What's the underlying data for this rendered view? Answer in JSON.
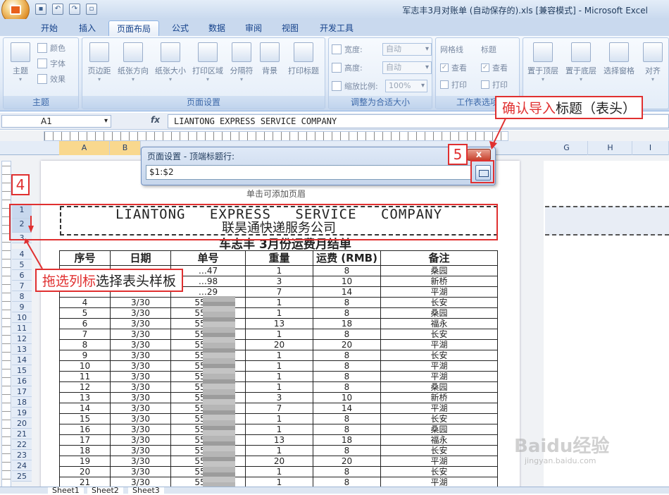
{
  "window": {
    "title": "军志丰3月对账单 (自动保存的).xls  [兼容模式] - Microsoft Excel"
  },
  "ribbon_tabs": [
    "开始",
    "插入",
    "页面布局",
    "公式",
    "数据",
    "审阅",
    "视图",
    "开发工具"
  ],
  "groups": {
    "theme": {
      "label": "主题",
      "big": "主题",
      "items": [
        "颜色",
        "字体",
        "效果"
      ]
    },
    "page_setup": {
      "label": "页面设置",
      "buttons": [
        "页边距",
        "纸张方向",
        "纸张大小",
        "打印区域",
        "分隔符",
        "背景",
        "打印标题"
      ]
    },
    "scale": {
      "label": "调整为合适大小",
      "width_label": "宽度:",
      "width_val": "自动",
      "height_label": "高度:",
      "height_val": "自动",
      "scale_label": "缩放比例:",
      "scale_val": "100%"
    },
    "sheet_opts": {
      "label": "工作表选项",
      "gridlines": "网格线",
      "headings": "标题",
      "view": "查看",
      "print": "打印"
    },
    "arrange": {
      "buttons": [
        "置于顶层",
        "置于底层",
        "选择窗格",
        "对齐"
      ]
    }
  },
  "formula": {
    "name_box": "A1",
    "fx": "fx",
    "content": "LIANTONG  EXPRESS  SERVICE  COMPANY"
  },
  "columns_left": [
    "A",
    "B"
  ],
  "columns_right": [
    "G",
    "H",
    "I"
  ],
  "page_header_hint": "单击可添加页眉",
  "dialog": {
    "title": "页面设置 - 顶端标题行:",
    "value": "$1:$2",
    "close": "x"
  },
  "sheet": {
    "header_en": "LIANTONG EXPRESS SERVICE COMPANY",
    "header_cn": "联昊通快递服务公司",
    "title": "车志丰    3月份运费月结单",
    "col_headers": [
      "序号",
      "日期",
      "单号",
      "重量",
      "运费 (RMB)",
      "备注"
    ],
    "rows": [
      [
        "",
        "",
        "…47",
        "1",
        "8",
        "桑园"
      ],
      [
        "",
        "",
        "…98",
        "3",
        "10",
        "新桥"
      ],
      [
        "",
        "",
        "…29",
        "7",
        "14",
        "平湖"
      ],
      [
        "4",
        "3/30",
        "55306",
        "1",
        "8",
        "长安"
      ],
      [
        "5",
        "3/30",
        "55306",
        "1",
        "8",
        "桑园"
      ],
      [
        "6",
        "3/30",
        "55306",
        "13",
        "18",
        "福永"
      ],
      [
        "7",
        "3/30",
        "55306",
        "1",
        "8",
        "长安"
      ],
      [
        "8",
        "3/30",
        "55306",
        "20",
        "20",
        "平湖"
      ],
      [
        "9",
        "3/30",
        "55306",
        "1",
        "8",
        "长安"
      ],
      [
        "10",
        "3/30",
        "55306",
        "1",
        "8",
        "平湖"
      ],
      [
        "11",
        "3/30",
        "55306",
        "1",
        "8",
        "平湖"
      ],
      [
        "12",
        "3/30",
        "55306",
        "1",
        "8",
        "桑园"
      ],
      [
        "13",
        "3/30",
        "55306",
        "3",
        "10",
        "新桥"
      ],
      [
        "14",
        "3/30",
        "55306",
        "7",
        "14",
        "平湖"
      ],
      [
        "15",
        "3/30",
        "55306",
        "1",
        "8",
        "长安"
      ],
      [
        "16",
        "3/30",
        "55306",
        "1",
        "8",
        "桑园"
      ],
      [
        "17",
        "3/30",
        "55306",
        "13",
        "18",
        "福永"
      ],
      [
        "18",
        "3/30",
        "55306",
        "1",
        "8",
        "长安"
      ],
      [
        "19",
        "3/30",
        "55306",
        "20",
        "20",
        "平湖"
      ],
      [
        "20",
        "3/30",
        "55306",
        "1",
        "8",
        "长安"
      ],
      [
        "21",
        "3/30",
        "55306",
        "1",
        "8",
        "平湖"
      ]
    ],
    "row_numbers": [
      "1",
      "2",
      "3",
      "4",
      "5",
      "6",
      "7",
      "8",
      "9",
      "10",
      "11",
      "12",
      "13",
      "14",
      "15",
      "16",
      "17",
      "18",
      "19",
      "20",
      "21",
      "22",
      "23",
      "24",
      "25"
    ]
  },
  "annotations": {
    "step4": "4",
    "step5": "5",
    "callout_drag_hl": "拖选列标",
    "callout_drag_rest": "选择表头样板",
    "callout_confirm_hl": "确认导入",
    "callout_confirm_rest": "标题（表头）"
  },
  "sheet_tabs": [
    "Sheet1",
    "Sheet2",
    "Sheet3"
  ],
  "watermark": {
    "brand": "Baidu经验",
    "url": "jingyan.baidu.com"
  }
}
